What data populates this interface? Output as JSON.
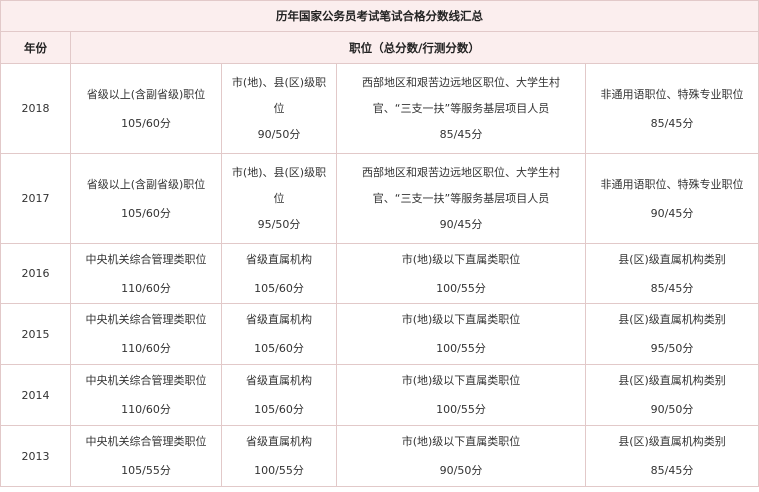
{
  "table": {
    "title": "历年国家公务员考试笔试合格分数线汇总",
    "year_header": "年份",
    "position_header": "职位（总分数/行测分数）",
    "rows": [
      {
        "year": "2018",
        "c1": {
          "name": "省级以上(含副省级)职位",
          "score": "105/60分"
        },
        "c2": {
          "name_a": "市(地)、县(区)级职",
          "name_b": "位",
          "score": "90/50分"
        },
        "c3": {
          "name_a": "西部地区和艰苦边远地区职位、大学生村",
          "name_b": "官、“三支一扶”等服务基层项目人员",
          "score": "85/45分"
        },
        "c4": {
          "name": "非通用语职位、特殊专业职位",
          "score": "85/45分"
        }
      },
      {
        "year": "2017",
        "c1": {
          "name": "省级以上(含副省级)职位",
          "score": "105/60分"
        },
        "c2": {
          "name_a": "市(地)、县(区)级职",
          "name_b": "位",
          "score": "95/50分"
        },
        "c3": {
          "name_a": "西部地区和艰苦边远地区职位、大学生村",
          "name_b": "官、“三支一扶”等服务基层项目人员",
          "score": "90/45分"
        },
        "c4": {
          "name": "非通用语职位、特殊专业职位",
          "score": "90/45分"
        }
      },
      {
        "year": "2016",
        "c1": {
          "name": "中央机关综合管理类职位",
          "score": "110/60分"
        },
        "c2": {
          "name": "省级直属机构",
          "score": "105/60分"
        },
        "c3": {
          "name": "市(地)级以下直属类职位",
          "score": "100/55分"
        },
        "c4": {
          "name": "县(区)级直属机构类别",
          "score": "85/45分"
        }
      },
      {
        "year": "2015",
        "c1": {
          "name": "中央机关综合管理类职位",
          "score": "110/60分"
        },
        "c2": {
          "name": "省级直属机构",
          "score": "105/60分"
        },
        "c3": {
          "name": "市(地)级以下直属类职位",
          "score": "100/55分"
        },
        "c4": {
          "name": "县(区)级直属机构类别",
          "score": "95/50分"
        }
      },
      {
        "year": "2014",
        "c1": {
          "name": "中央机关综合管理类职位",
          "score": "110/60分"
        },
        "c2": {
          "name": "省级直属机构",
          "score": "105/60分"
        },
        "c3": {
          "name": "市(地)级以下直属类职位",
          "score": "100/55分"
        },
        "c4": {
          "name": "县(区)级直属机构类别",
          "score": "90/50分"
        }
      },
      {
        "year": "2013",
        "c1": {
          "name": "中央机关综合管理类职位",
          "score": "105/55分"
        },
        "c2": {
          "name": "省级直属机构",
          "score": "100/55分"
        },
        "c3": {
          "name": "市(地)级以下直属类职位",
          "score": "90/50分"
        },
        "c4": {
          "name": "县(区)级直属机构类别",
          "score": "85/45分"
        }
      }
    ]
  }
}
